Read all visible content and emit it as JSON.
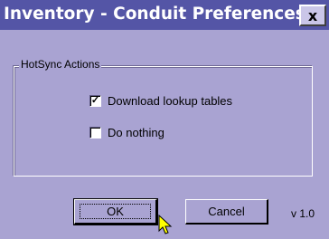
{
  "window": {
    "title": "Inventory - Conduit Preferences",
    "close_glyph": "x"
  },
  "group": {
    "legend": "HotSync Actions",
    "options": [
      {
        "label": "Download lookup tables",
        "checked": true
      },
      {
        "label": "Do nothing",
        "checked": false
      }
    ]
  },
  "buttons": {
    "ok": "OK",
    "cancel": "Cancel"
  },
  "version": "v 1.0",
  "colors": {
    "background": "#a9a3d2",
    "titlebar": "#5455a6"
  }
}
